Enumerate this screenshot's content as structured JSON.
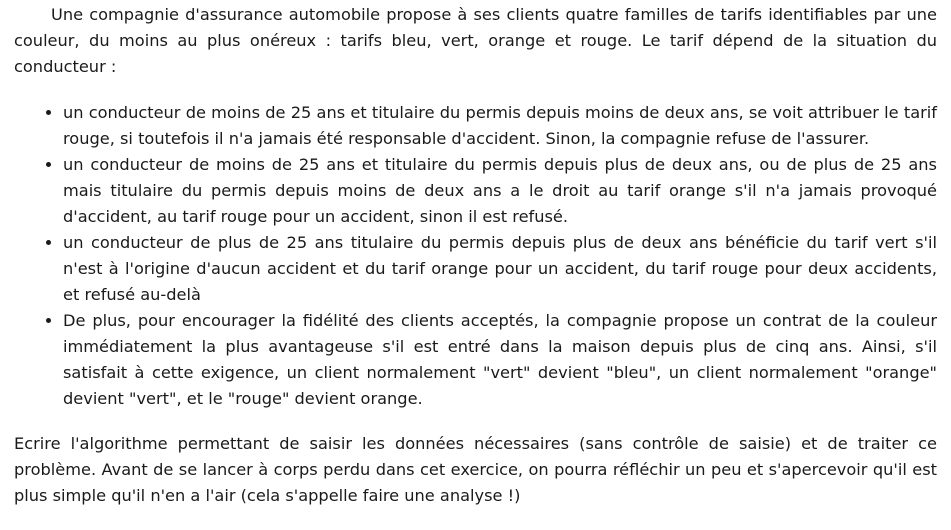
{
  "intro": "Une compagnie d'assurance automobile propose à ses clients quatre familles de tarifs identifiables par une couleur, du moins au plus onéreux : tarifs bleu, vert, orange et rouge. Le tarif dépend de la situation du conducteur :",
  "bullets": [
    "un conducteur de moins de 25 ans et titulaire du permis depuis moins de deux ans, se voit attribuer le tarif rouge, si toutefois il n'a jamais été responsable d'accident. Sinon, la compagnie refuse de l'assurer.",
    "un conducteur de moins de 25 ans et titulaire du permis depuis plus de deux ans, ou de plus de 25 ans mais titulaire du permis depuis moins de deux ans a le droit au tarif orange s'il n'a jamais provoqué d'accident, au tarif rouge pour un accident, sinon il est refusé.",
    "un conducteur de plus de 25 ans titulaire du permis depuis plus de deux ans bénéficie du tarif vert s'il n'est à l'origine d'aucun accident et du tarif orange pour un accident, du tarif rouge pour deux accidents, et refusé au-delà",
    "De plus, pour encourager la fidélité des clients acceptés, la compagnie propose un contrat de la couleur immédiatement la plus avantageuse s'il est entré dans la maison depuis plus de cinq ans. Ainsi, s'il satisfait à cette exigence, un client normalement \"vert\" devient \"bleu\", un client normalement \"orange\" devient \"vert\", et le \"rouge\" devient orange."
  ],
  "conclusion": "Ecrire l'algorithme permettant de saisir les données nécessaires (sans contrôle de saisie) et de traiter ce problème. Avant de se lancer à corps perdu dans cet exercice, on pourra réfléchir un peu et s'apercevoir qu'il est plus simple qu'il n'en a l'air (cela s'appelle faire une analyse !)"
}
